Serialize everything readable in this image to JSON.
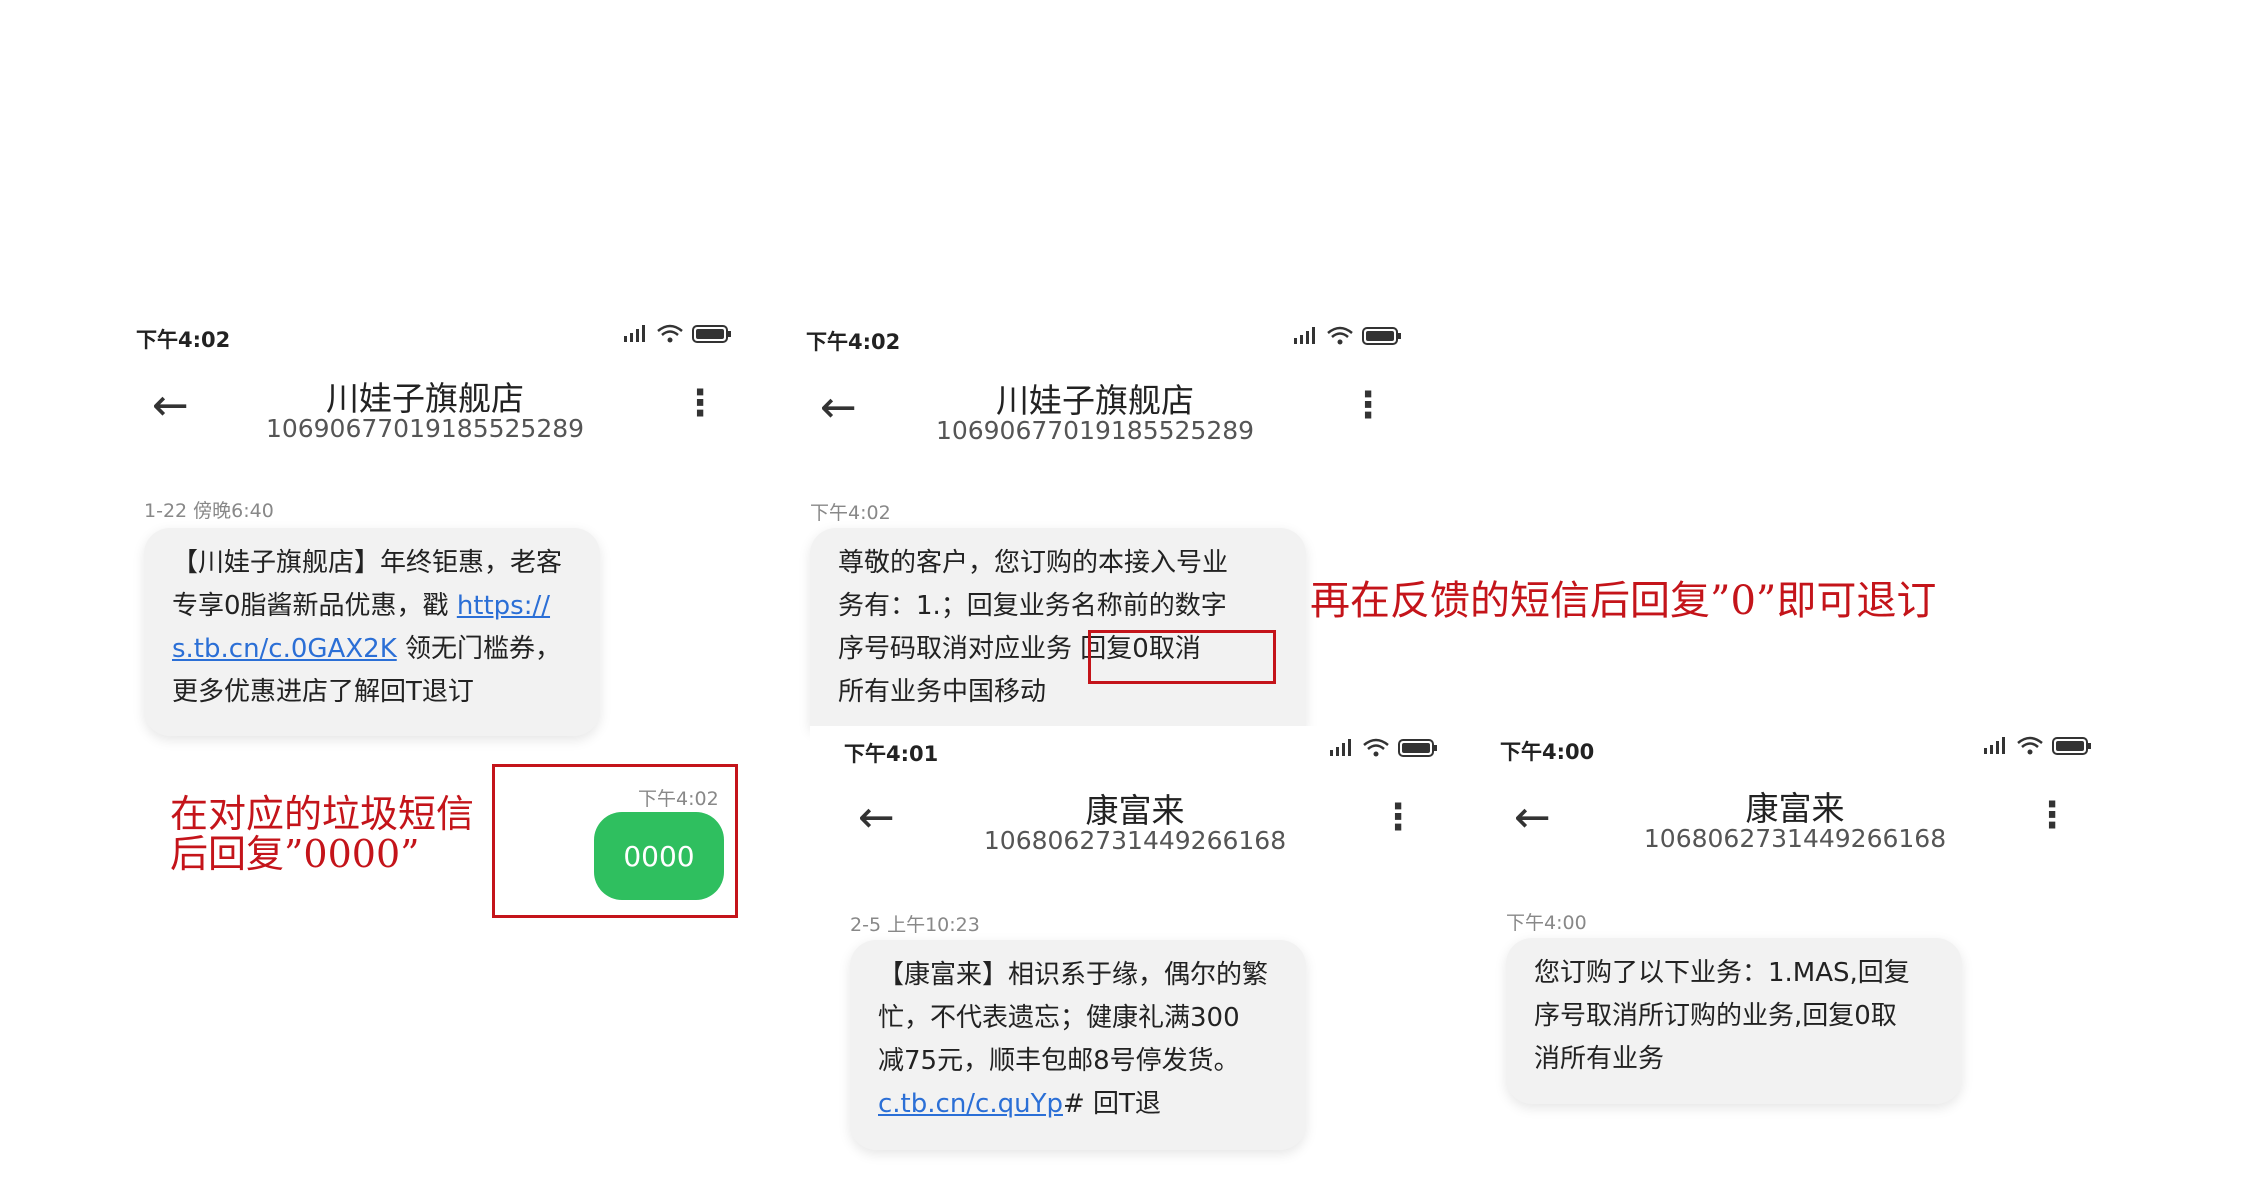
{
  "screens": {
    "a": {
      "status_time": "下午4:02",
      "contact_name": "川娃子旗舰店",
      "contact_number": "106906770191855252​89",
      "msg_time": "1-22 傍晚6:40",
      "msg_line1": "【川娃子旗舰店】年终钜惠，老客",
      "msg_line2a": "专享0脂酱新品优惠，戳 ",
      "msg_link1": "https://",
      "msg_link2": "s.tb.cn/c.0GAX2K",
      "msg_line3b": " 领无门槛券，",
      "msg_line4": "更多优惠进店了解回T退订",
      "sent_time": "下午4:02",
      "sent_text": "0000"
    },
    "b": {
      "status_time": "下午4:02",
      "contact_name": "川娃子旗舰店",
      "contact_number": "10690677019185525289",
      "msg_time": "下午4:02",
      "msg_line1": "尊敬的客户，您订购的本接入号业",
      "msg_line2": "务有：1.；回复业务名称前的数字",
      "msg_line3": "序号码取消对应业务",
      "msg_line3_boxed": "回复0取消",
      "msg_line4": "所有业务中国移动"
    },
    "c": {
      "status_time": "下午4:01",
      "contact_name": "康富来",
      "contact_number": "1068062731449266168",
      "msg_time": "2-5 上午10:23",
      "msg_line1": "【康富来】相识系于缘，偶尔的繁",
      "msg_line2": "忙，不代表遗忘；健康礼满300",
      "msg_line3": "减75元，顺丰包邮8号停发货。",
      "msg_link": "c.tb.cn/c.quYp",
      "msg_line4b": "# 回T退"
    },
    "d": {
      "status_time": "下午4:00",
      "contact_name": "康富来",
      "contact_number": "1068062731449266168",
      "msg_time": "下午4:00",
      "msg_line1": "您订购了以下业务：1.MAS,回复",
      "msg_line2": "序号取消所订购的业务,回复0取",
      "msg_line3": "消所有业务"
    }
  },
  "annotations": {
    "left_line1": "在对应的垃圾短信",
    "left_line2": "后回复”0000”",
    "right": "再在反馈的短信后回复”0”即可退订"
  },
  "colors": {
    "annotation_red": "#c4141a",
    "sent_green": "#2fbf5f",
    "link_blue": "#2b6fd6"
  }
}
